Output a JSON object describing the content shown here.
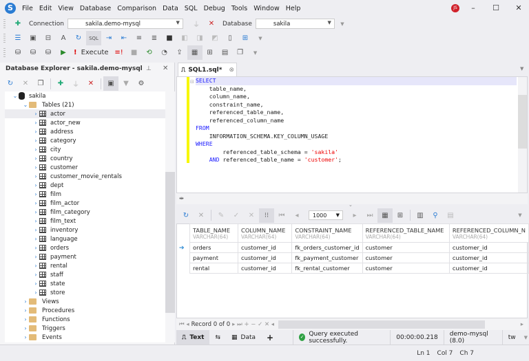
{
  "app": {
    "logo": "S",
    "user_initials": "JS"
  },
  "menu": [
    "File",
    "Edit",
    "View",
    "Database",
    "Comparison",
    "Data",
    "SQL",
    "Debug",
    "Tools",
    "Window",
    "Help"
  ],
  "window_controls": {
    "minimize": "–",
    "maximize": "☐",
    "close": "✕"
  },
  "toolbar1": {
    "connection_label": "Connection",
    "connection_value": "sakila.demo-mysql",
    "database_label": "Database",
    "database_value": "sakila"
  },
  "toolbar3": {
    "execute_label": "Execute"
  },
  "explorer": {
    "title": "Database Explorer - sakila.demo-mysql",
    "root": "sakila",
    "tables_folder": "Tables (21)",
    "tables": [
      "actor",
      "actor_new",
      "address",
      "category",
      "city",
      "country",
      "customer",
      "customer_movie_rentals",
      "dept",
      "film",
      "film_actor",
      "film_category",
      "film_text",
      "inventory",
      "language",
      "orders",
      "payment",
      "rental",
      "staff",
      "state",
      "store"
    ],
    "folders": [
      "Views",
      "Procedures",
      "Functions",
      "Triggers",
      "Events"
    ]
  },
  "editor": {
    "tab_label": "SQL1.sql*",
    "lines": [
      [
        {
          "t": "SELECT",
          "c": "kw"
        }
      ],
      [
        {
          "t": "    table_name,"
        }
      ],
      [
        {
          "t": "    column_name,"
        }
      ],
      [
        {
          "t": "    constraint_name,"
        }
      ],
      [
        {
          "t": "    referenced_table_name,"
        }
      ],
      [
        {
          "t": "    referenced_column_name"
        }
      ],
      [
        {
          "t": "FROM",
          "c": "kw"
        }
      ],
      [
        {
          "t": "    INFORMATION_SCHEMA.KEY_COLUMN_USAGE"
        }
      ],
      [
        {
          "t": "WHERE",
          "c": "kw"
        }
      ],
      [
        {
          "t": "        referenced_table_schema = "
        },
        {
          "t": "'sakila'",
          "c": "str"
        }
      ],
      [
        {
          "t": "    "
        },
        {
          "t": "AND",
          "c": "kw"
        },
        {
          "t": " referenced_table_name = "
        },
        {
          "t": "'customer'",
          "c": "str"
        },
        {
          "t": ";"
        }
      ]
    ]
  },
  "results": {
    "row_limit": "1000",
    "columns": [
      {
        "name": "TABLE_NAME",
        "type": "VARCHAR(64)"
      },
      {
        "name": "COLUMN_NAME",
        "type": "VARCHAR(64)"
      },
      {
        "name": "CONSTRAINT_NAME",
        "type": "VARCHAR(64)"
      },
      {
        "name": "REFERENCED_TABLE_NAME",
        "type": "VARCHAR(64)"
      },
      {
        "name": "REFERENCED_COLUMN_N",
        "type": "VARCHAR(64)"
      }
    ],
    "rows": [
      [
        "orders",
        "customer_id",
        "fk_orders_customer_id",
        "customer",
        "customer_id"
      ],
      [
        "payment",
        "customer_id",
        "fk_payment_customer",
        "customer",
        "customer_id"
      ],
      [
        "rental",
        "customer_id",
        "fk_rental_customer",
        "customer",
        "customer_id"
      ]
    ],
    "record_text": "Record 0 of 0"
  },
  "bottom": {
    "text_tab": "Text",
    "data_tab": "Data",
    "add": "+",
    "status_message": "Query executed successfully.",
    "elapsed": "00:00:00.218",
    "server": "demo-mysql (8.0)",
    "extra": "tw"
  },
  "statusbar": {
    "ln": "Ln 1",
    "col": "Col 7",
    "ch": "Ch 7"
  }
}
